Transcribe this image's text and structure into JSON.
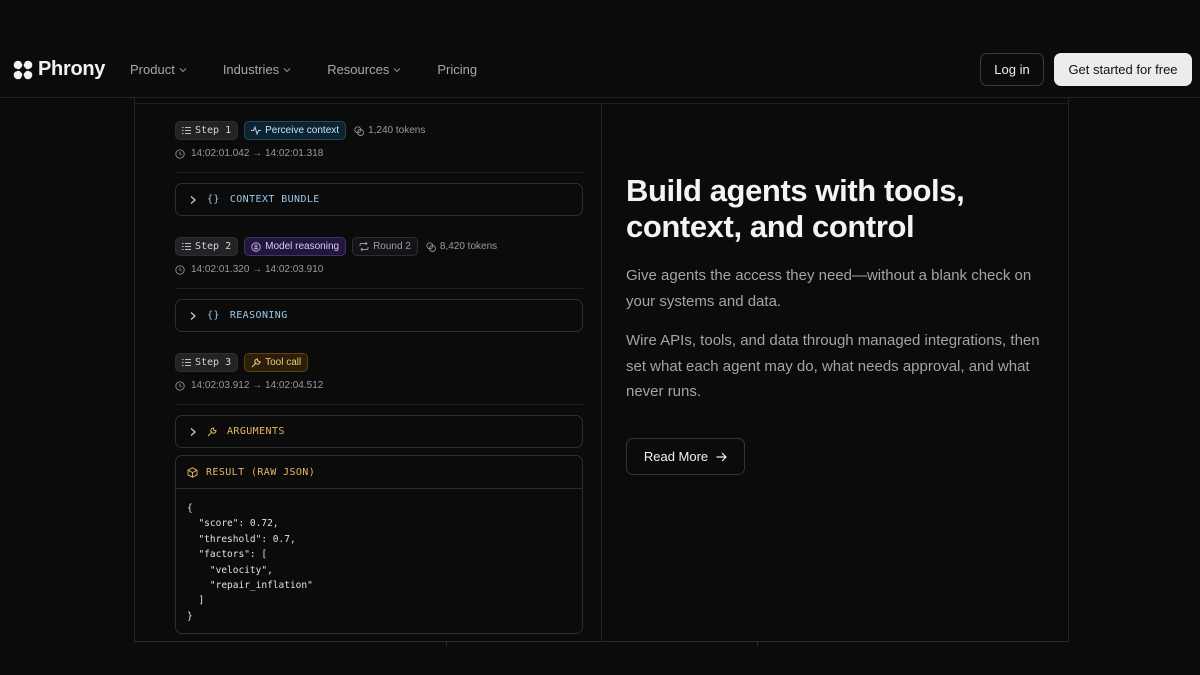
{
  "nav": {
    "brand": "Phrony",
    "links": [
      {
        "label": "Product",
        "has_menu": true
      },
      {
        "label": "Industries",
        "has_menu": true
      },
      {
        "label": "Resources",
        "has_menu": true
      },
      {
        "label": "Pricing",
        "has_menu": false
      }
    ],
    "login_label": "Log in",
    "cta_label": "Get started for free"
  },
  "trace": {
    "steps": [
      {
        "step_label": "Step 1",
        "action_label": "Perceive context",
        "action_icon": "activity-icon",
        "tokens": "1,240 tokens",
        "time": "14:02:01.042 → 14:02:01.318",
        "section_label": "CONTEXT BUNDLE"
      },
      {
        "step_label": "Step 2",
        "action_label": "Model reasoning",
        "action_icon": "brain-icon",
        "round_label": "Round 2",
        "tokens": "8,420 tokens",
        "time": "14:02:01.320 → 14:02:03.910",
        "section_label": "REASONING"
      },
      {
        "step_label": "Step 3",
        "action_label": "Tool call",
        "action_icon": "wrench-icon",
        "time": "14:02:03.912 → 14:02:04.512",
        "section_label": "ARGUMENTS"
      }
    ],
    "result_label": "RESULT (RAW JSON)",
    "result_json": "{\n  \"score\": 0.72,\n  \"threshold\": 0.7,\n  \"factors\": [\n    \"velocity\",\n    \"repair_inflation\"\n  ]\n}"
  },
  "hero": {
    "title": "Build agents with tools, context, and control",
    "para1": "Give agents the access they need—without a blank check on your systems and data.",
    "para2": "Wire APIs, tools, and data through managed integrations, then set what each agent may do, what needs approval, and what never runs.",
    "read_more_label": "Read More"
  },
  "colors": {
    "background": "#0b0b0c",
    "accent_blue": "#bfe4ff",
    "accent_purple": "#dccbff",
    "accent_amber": "#f3c877"
  }
}
